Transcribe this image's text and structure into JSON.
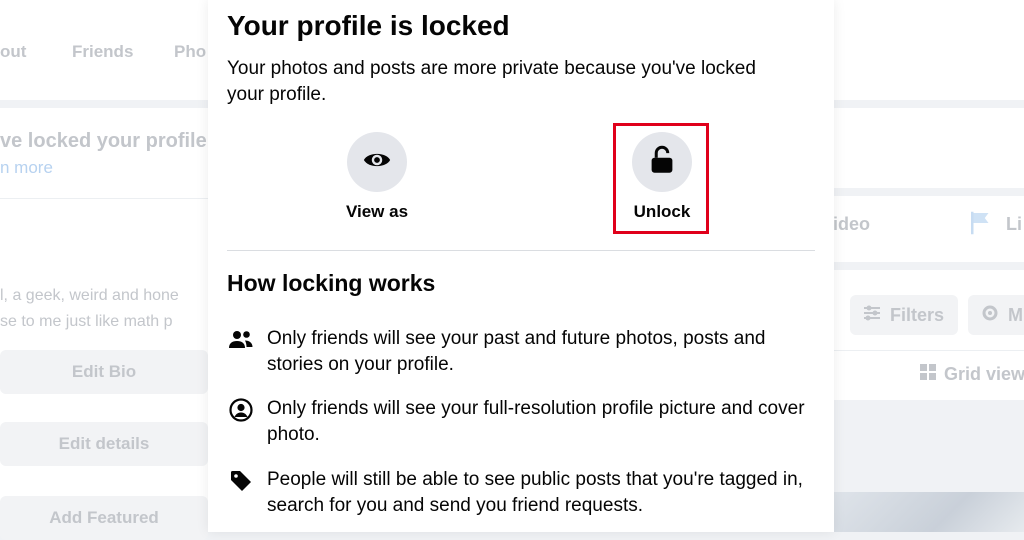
{
  "background": {
    "tabs": [
      "out",
      "Friends",
      "Pho"
    ],
    "lock_notice": "ve locked your profile",
    "learn_more": "n more",
    "bio_line1": "l, a geek, weird and hone",
    "bio_line2": "se to me just like math p",
    "buttons": [
      "Edit Bio",
      "Edit details",
      "Add Featured"
    ],
    "right": {
      "video": "ideo",
      "life_event": "Li",
      "filters": "Filters",
      "manage": "M",
      "grid_view": "Grid view"
    }
  },
  "modal": {
    "title": "Your profile is locked",
    "subtitle": "Your photos and posts are more private because you've locked your profile.",
    "actions": {
      "view_as": "View as",
      "unlock": "Unlock"
    },
    "section_title": "How locking works",
    "info": [
      {
        "icon": "friends-icon",
        "text": "Only friends will see your past and future photos, posts and stories on your profile."
      },
      {
        "icon": "profile-picture-icon",
        "text": "Only friends will see your full-resolution profile picture and cover photo."
      },
      {
        "icon": "tag-icon",
        "text": "People will still be able to see public posts that you're tagged in, search for you and send you friend requests."
      }
    ]
  },
  "colors": {
    "highlight": "#e0001b",
    "icon_circle": "#e4e6eb",
    "text": "#050505"
  }
}
